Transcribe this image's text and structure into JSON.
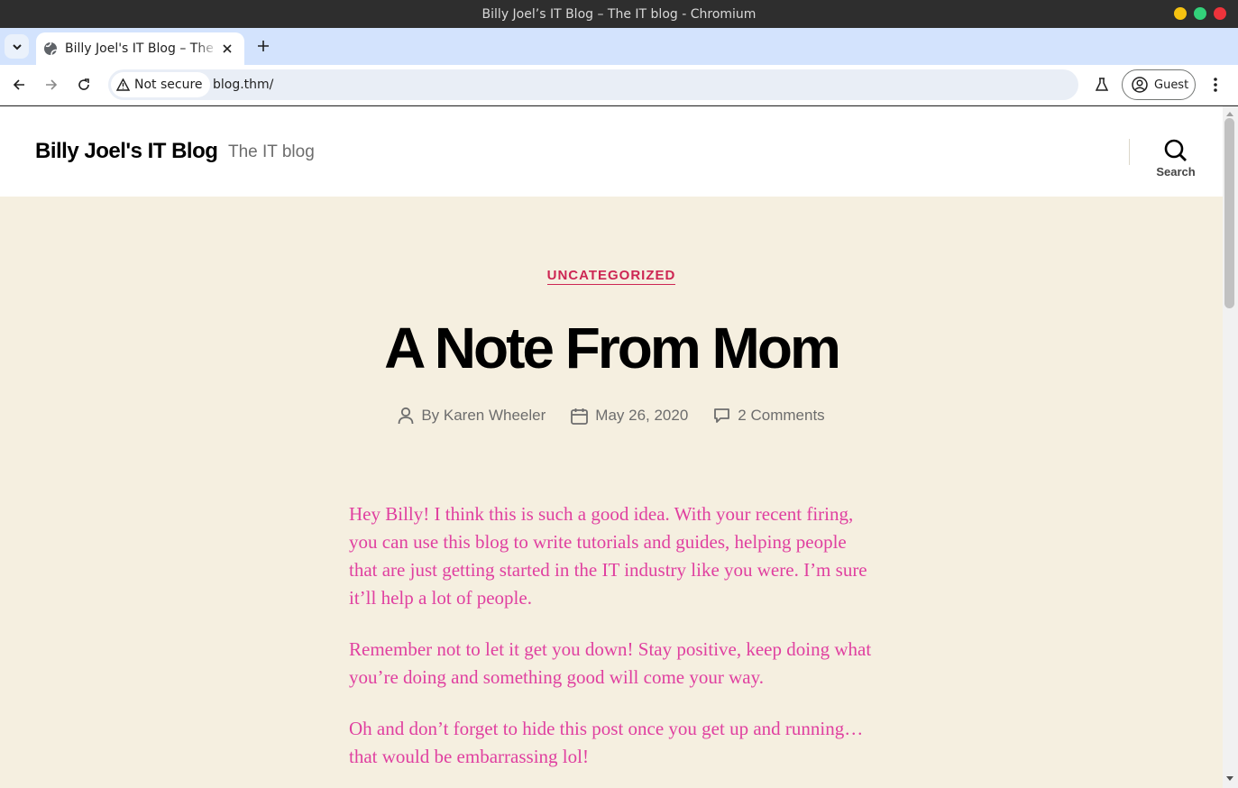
{
  "window": {
    "title": "Billy Joel’s IT Blog – The IT blog - Chromium",
    "controls": {
      "minimize_color": "#f5c211",
      "maximize_color": "#33d17a",
      "close_color": "#ed333b"
    }
  },
  "browser": {
    "tab": {
      "title": "Billy Joel's IT Blog – The IT blog"
    },
    "address_bar": {
      "security_label": "Not secure",
      "url": "blog.thm/"
    },
    "profile_label": "Guest"
  },
  "site": {
    "title": "Billy Joel's IT Blog",
    "description": "The IT blog",
    "search_label": "Search"
  },
  "post": {
    "category": "UNCATEGORIZED",
    "title": "A Note From Mom",
    "author": "By Karen Wheeler",
    "date": "May 26, 2020",
    "comments": "2 Comments",
    "paragraphs": [
      "Hey Billy!  I think this is such a good idea.  With your recent firing, you can use this blog to write tutorials and guides, helping people that are just getting started in the IT industry like you were.  I’m sure it’ll help a lot of people.",
      "Remember not to let it get you down!  Stay positive, keep doing what you’re doing and something good will come your way.",
      "Oh and don’t forget to hide this post once you get up and running… that would be embarrassing lol!"
    ]
  },
  "colors": {
    "page_background": "#f5efe0",
    "accent": "#cd2653",
    "content_text": "#e040a0",
    "tabstrip": "#d3e3fd"
  }
}
